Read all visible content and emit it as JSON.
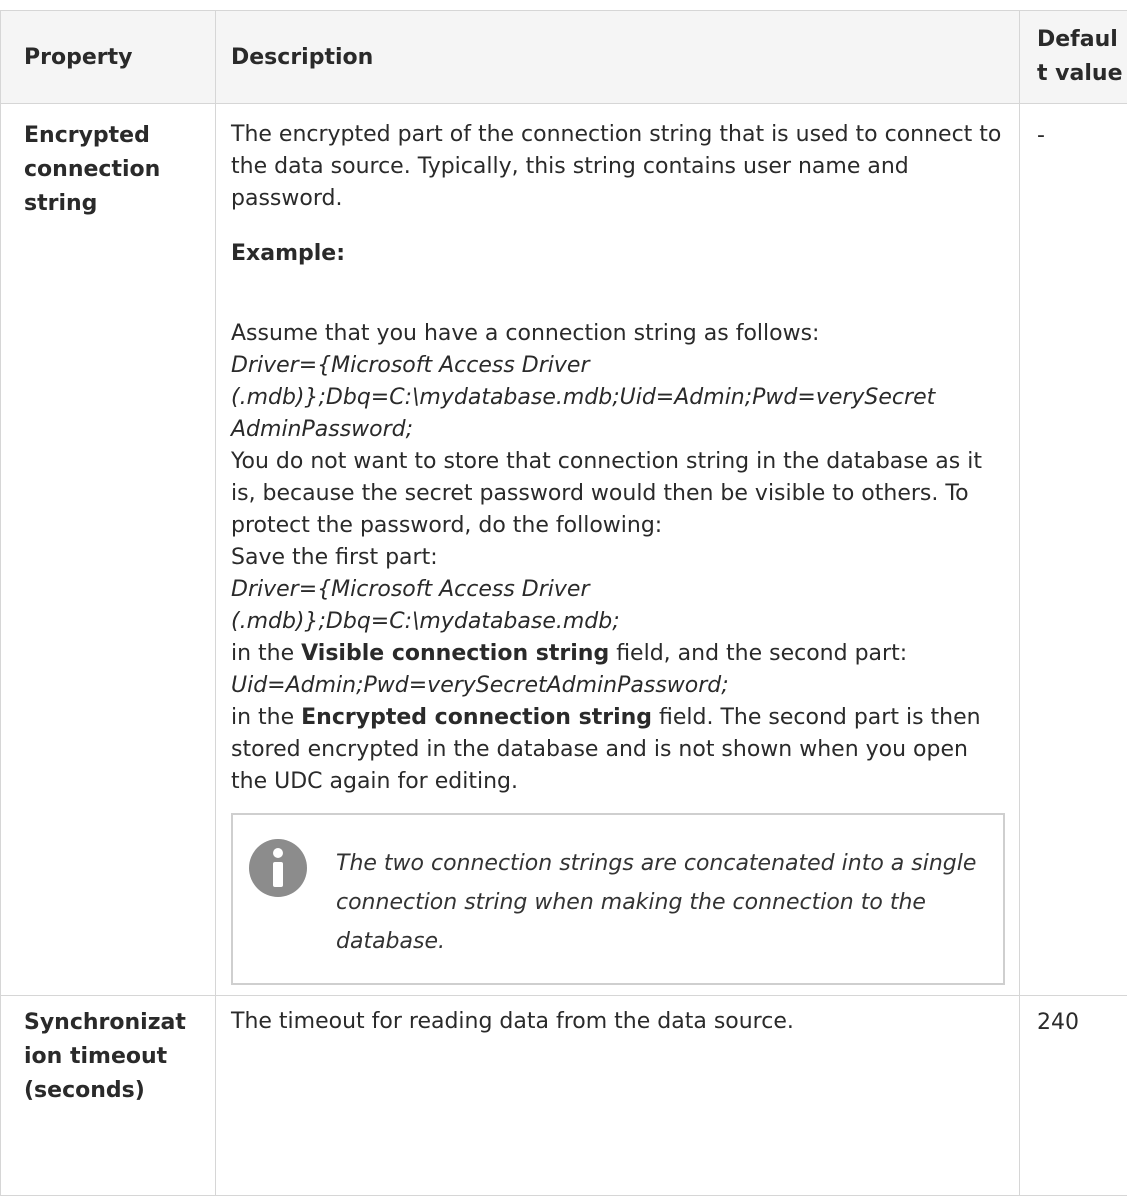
{
  "table": {
    "headers": {
      "property": "Property",
      "description": "Description",
      "default_line1": "Defaul",
      "default_line2": "t value"
    },
    "rows": [
      {
        "property_lines": [
          "Encrypted",
          "connection",
          "string"
        ],
        "description": {
          "intro": "The encrypted part of the connection string that is used to connect to the data source. Typically, this string contains user name and password.",
          "example_heading": "Example:",
          "assume": "Assume that you have a connection string as follows:",
          "full_string_l1": "Driver={Microsoft Access Driver",
          "full_string_l2": "(.mdb)};Dbq=C:\\mydatabase.mdb;Uid=Admin;Pwd=verySecret",
          "full_string_l3": "AdminPassword;",
          "explain": "You do not want to store that connection string in the database as it is, because the secret password would then be visible to others. To protect the password, do the following:",
          "save_first": "Save the first part:",
          "first_part_l1": "Driver={Microsoft Access Driver",
          "first_part_l2": "(.mdb)};Dbq=C:\\mydatabase.mdb;",
          "in_the_1": "in the ",
          "visible_field": "Visible connection string",
          "field_and_second": " field, and the second part:",
          "second_part": "Uid=Admin;Pwd=verySecretAdminPassword;",
          "in_the_2": "in the ",
          "encrypted_field": "Encrypted connection string",
          "field_tail": " field. The second part is then stored encrypted in the database and is not shown when you open the UDC again for editing.",
          "note": "The two connection strings are concatenated into a single connection string when making the connection to the database."
        },
        "default": "-"
      },
      {
        "property_lines": [
          "Synchronizat",
          "ion timeout",
          "(seconds)"
        ],
        "description": "The timeout for reading data from the data source.",
        "default": "240"
      }
    ]
  },
  "icons": {
    "note_icon": "info-icon",
    "note_icon_color": "#8c8c8c"
  }
}
